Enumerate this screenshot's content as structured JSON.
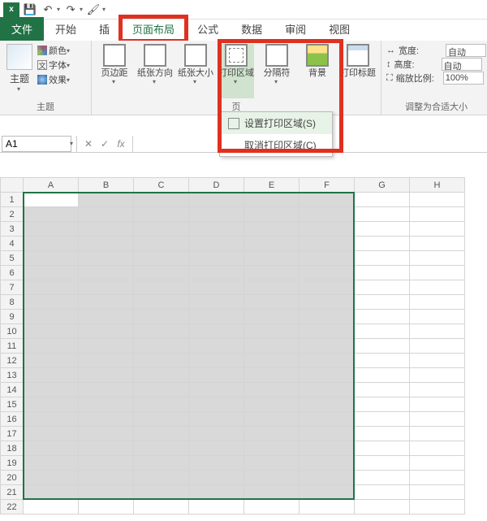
{
  "qat": {
    "save": "💾",
    "undo": "↶",
    "redo": "↷",
    "brush": "🖌"
  },
  "tabs": {
    "file": "文件",
    "home": "开始",
    "t2": "插",
    "layout": "页面布局",
    "formulas": "公式",
    "data": "数据",
    "review": "审阅",
    "view": "视图"
  },
  "theme": {
    "big": "主题",
    "colors": "颜色",
    "fonts": "字体",
    "effects": "效果",
    "group": "主题"
  },
  "pagesetup": {
    "margins": "页边距",
    "orientation": "纸张方向",
    "size": "纸张大小",
    "printarea": "打印区域",
    "breaks": "分隔符",
    "bg": "背景",
    "titles": "打印标题",
    "group": "页"
  },
  "scale": {
    "widthLabel": "宽度:",
    "widthVal": "自动",
    "heightLabel": "高度:",
    "heightVal": "自动",
    "scaleLabel": "缩放比例:",
    "scaleVal": "100%",
    "group": "调整为合适大小"
  },
  "menu": {
    "set": "设置打印区域(S)",
    "clear": "取消打印区域(C)"
  },
  "namebox": "A1",
  "cols": [
    "A",
    "B",
    "C",
    "D",
    "E",
    "F",
    "G",
    "H"
  ],
  "rows": [
    "1",
    "2",
    "3",
    "4",
    "5",
    "6",
    "7",
    "8",
    "9",
    "10",
    "11",
    "12",
    "13",
    "14",
    "15",
    "16",
    "17",
    "18",
    "19",
    "20",
    "21",
    "22"
  ]
}
